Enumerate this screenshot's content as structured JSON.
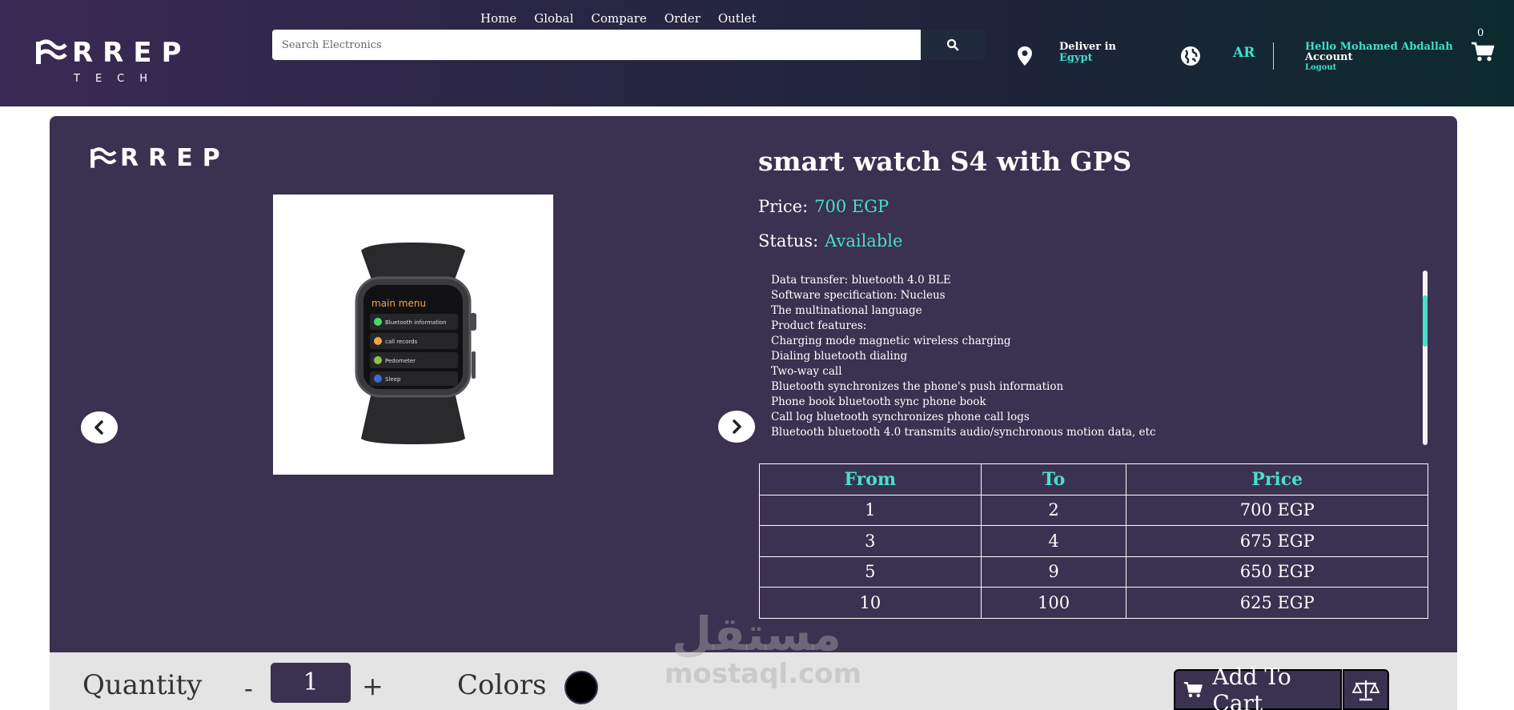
{
  "header": {
    "logo_word": "RREP",
    "logo_sub": "TECH",
    "nav": [
      "Home",
      "Global",
      "Compare",
      "Order",
      "Outlet"
    ],
    "search_placeholder": "Search Electronics",
    "deliver_label": "Deliver in",
    "deliver_country": "Egypt",
    "language": "AR",
    "greeting": "Hello Mohamed Abdallah",
    "account_label": "Account",
    "logout_label": "Logout",
    "cart_count": "0"
  },
  "product": {
    "card_logo": "RREP",
    "title": "smart watch S4 with GPS",
    "price_label": "Price:",
    "price_value": "700 EGP",
    "status_label": "Status:",
    "status_value": "Available",
    "image": {
      "menu_title": "main menu",
      "menu_items": [
        "Bluetooth information",
        "call records",
        "Pedometer",
        "Sleep"
      ]
    },
    "description_lines": [
      "Data transfer: bluetooth 4.0 BLE",
      "Software specification: Nucleus",
      "The multinational language",
      "Product features:",
      "Charging mode magnetic wireless charging",
      "Dialing bluetooth dialing",
      "Two-way call",
      "Bluetooth synchronizes the phone's push information",
      "Phone book bluetooth sync phone book",
      "Call log bluetooth synchronizes phone call logs",
      "Bluetooth bluetooth 4.0 transmits audio/synchronous motion data, etc"
    ],
    "description_scroll_fraction": 0.2
  },
  "price_table": {
    "headers": [
      "From",
      "To",
      "Price"
    ],
    "rows": [
      [
        "1",
        "2",
        "700 EGP"
      ],
      [
        "3",
        "4",
        "675 EGP"
      ],
      [
        "5",
        "9",
        "650 EGP"
      ],
      [
        "10",
        "100",
        "625 EGP"
      ]
    ]
  },
  "purchase": {
    "quantity_label": "Quantity",
    "minus": "-",
    "quantity_value": "1",
    "plus": "+",
    "colors_label": "Colors",
    "selected_color": "#000000",
    "add_to_cart_label": "Add To Cart"
  },
  "watermark": {
    "arabic": "مستقل",
    "latin": "mostaql.com"
  },
  "colors": {
    "accent": "#49dfc9",
    "card_bg": "#3b3150"
  },
  "icons": [
    "location-pin-icon",
    "globe-icon",
    "cart-icon",
    "search-icon",
    "chevron-left-icon",
    "chevron-right-icon",
    "scale-icon"
  ]
}
